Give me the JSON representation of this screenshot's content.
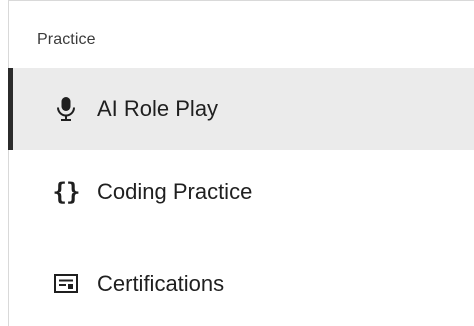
{
  "section": {
    "title": "Practice"
  },
  "nav": {
    "items": [
      {
        "label": "AI Role Play",
        "icon": "microphone-icon",
        "selected": true
      },
      {
        "label": "Coding Practice",
        "icon": "code-braces-icon",
        "selected": false
      },
      {
        "label": "Certifications",
        "icon": "certificate-icon",
        "selected": false
      }
    ]
  },
  "colors": {
    "selected_background": "#ebebeb",
    "selected_indicator": "#2b2b2b",
    "text": "#1f1f1f",
    "border": "#d9d9d9"
  }
}
